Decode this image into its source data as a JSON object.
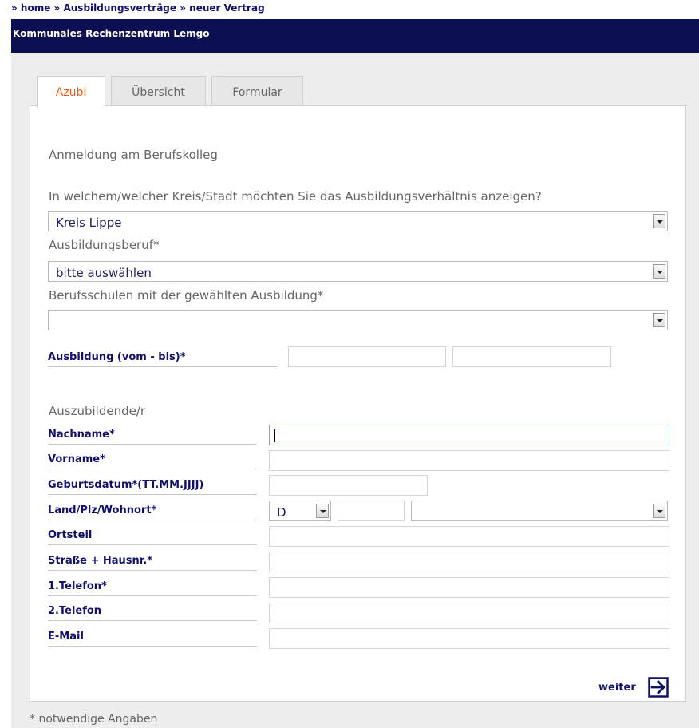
{
  "breadcrumb": {
    "items": [
      "» home",
      "» Ausbildungsverträge",
      "» neuer Vertrag"
    ]
  },
  "header": {
    "title": "Kommunales Rechenzentrum Lemgo"
  },
  "tabs": [
    {
      "label": "Azubi",
      "active": true
    },
    {
      "label": "Übersicht",
      "active": false
    },
    {
      "label": "Formular",
      "active": false
    }
  ],
  "form": {
    "section_berufskolleg": "Anmeldung am Berufskolleg",
    "kreis_question": "In welchem/welcher Kreis/Stadt möchten Sie das Ausbildungsverhältnis anzeigen?",
    "kreis_value": "Kreis Lippe",
    "beruf_label": "Ausbildungsberuf*",
    "beruf_value": "bitte auswählen",
    "schulen_label": "Berufsschulen mit der gewählten Ausbildung*",
    "schulen_value": "",
    "ausbildung_label": "Ausbildung (vom - bis)*",
    "section_azubi": "Auszubildende/r",
    "fields": {
      "nachname": "Nachname*",
      "vorname": "Vorname*",
      "geburtsdatum": "Geburtsdatum*(TT.MM.JJJJ)",
      "land": "Land/Plz/Wohnort*",
      "ortsteil": "Ortsteil",
      "strasse": "Straße + Hausnr.*",
      "telefon1": "1.Telefon*",
      "telefon2": "2.Telefon",
      "email": "E-Mail"
    },
    "land_value": "D",
    "weiter_label": "weiter",
    "footnote": "* notwendige Angaben"
  },
  "colors": {
    "header_bg": "#0d0f55",
    "active_tab_text": "#f25c1a",
    "label_text": "#10106a"
  },
  "icons": {
    "weiter": "arrow-right-box-icon",
    "dropdown": "chevron-down-icon"
  }
}
